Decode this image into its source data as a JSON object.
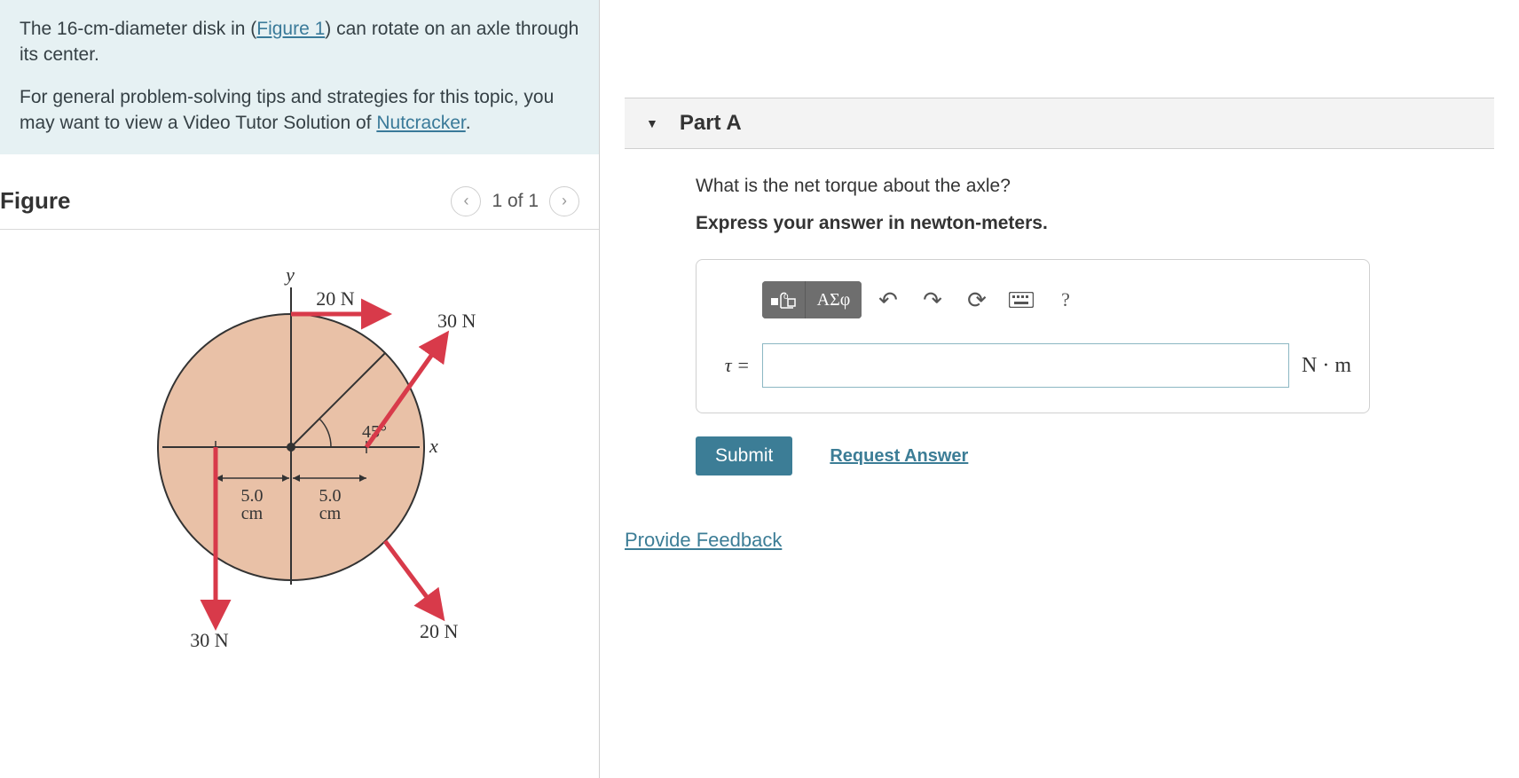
{
  "problem": {
    "para1_pre": "The 16-cm-diameter disk in (",
    "figure_link": "Figure 1",
    "para1_post": ") can rotate on an axle through its center.",
    "para2_pre": "For general problem-solving tips and strategies for this topic, you may want to view a Video Tutor Solution of ",
    "video_link": "Nutcracker",
    "para2_post": "."
  },
  "figure": {
    "heading": "Figure",
    "prev_glyph": "‹",
    "counter": "1 of 1",
    "next_glyph": "›",
    "labels": {
      "y": "y",
      "x": "x",
      "angle": "45°",
      "f_top": "20 N",
      "f_topright": "30 N",
      "f_bottomleft": "30 N",
      "f_bottomright": "20 N",
      "r_left": "5.0\ncm",
      "r_right": "5.0\ncm"
    }
  },
  "part": {
    "title": "Part A",
    "question": "What is the net torque about the axle?",
    "instruction": "Express your answer in newton-meters.",
    "toolbar": {
      "templates_tip": "templates",
      "symbols_label": "ΑΣφ",
      "undo_glyph": "↶",
      "redo_glyph": "↷",
      "reset_glyph": "⟳",
      "keyboard_glyph": "⌨",
      "help_glyph": "?"
    },
    "answer": {
      "var_label": "τ =",
      "value": "",
      "unit": "N · m"
    },
    "submit_label": "Submit",
    "request_label": "Request Answer"
  },
  "feedback_link": "Provide Feedback"
}
